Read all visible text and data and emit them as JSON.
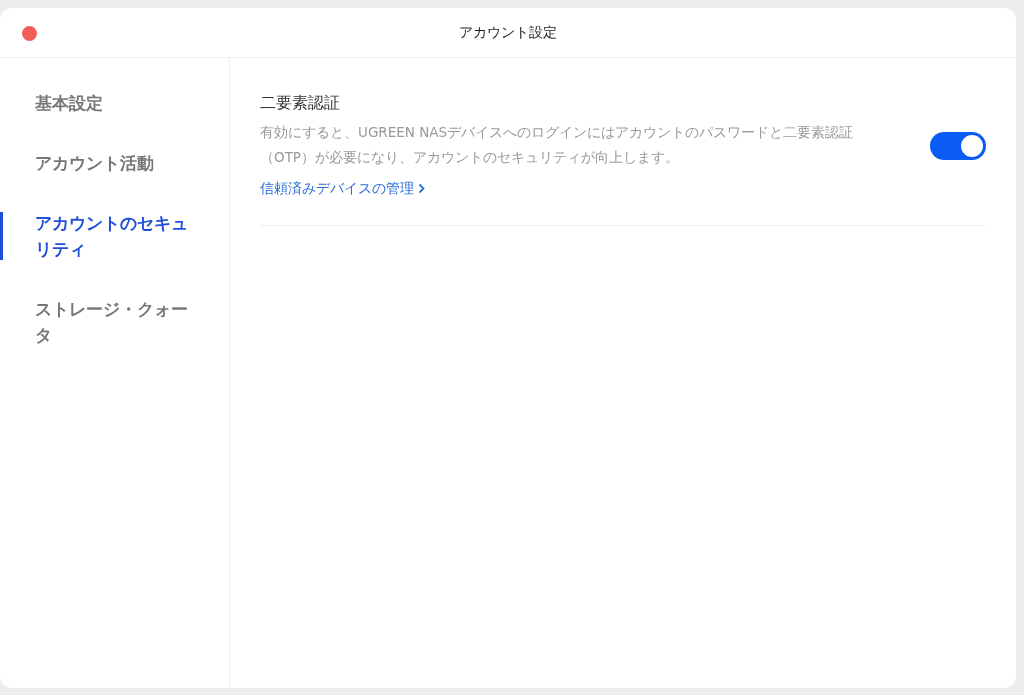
{
  "window": {
    "title": "アカウント設定"
  },
  "sidebar": {
    "items": [
      {
        "label": "基本設定",
        "selected": false
      },
      {
        "label": "アカウント活動",
        "selected": false
      },
      {
        "label": "アカウントのセキュリティ",
        "selected": true
      },
      {
        "label": "ストレージ・クォータ",
        "selected": false
      }
    ]
  },
  "setting": {
    "title": "二要素認証",
    "description": "有効にすると、UGREEN NASデバイスへのログインにはアカウントのパスワードと二要素認証（OTP）が必要になり、アカウントのセキュリティが向上します。",
    "link": "信頼済みデバイスの管理",
    "on": true
  }
}
